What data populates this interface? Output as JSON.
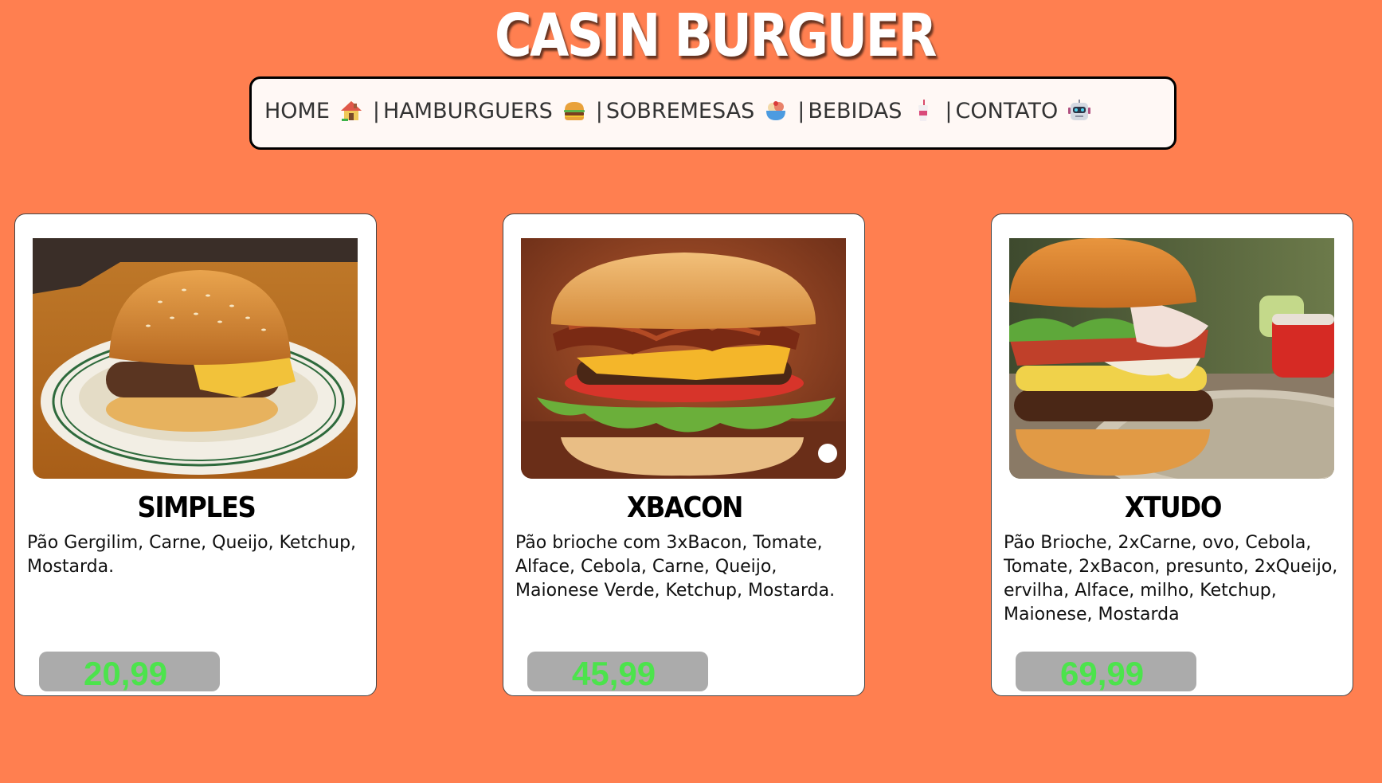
{
  "site": {
    "title": "CASIN BURGUER",
    "background_color": "#FF7F50"
  },
  "nav": {
    "items": [
      {
        "label": "HOME",
        "icon": "house-icon",
        "separator": ""
      },
      {
        "label": "HAMBURGUERS",
        "icon": "burger-icon",
        "separator": "|"
      },
      {
        "label": "SOBREMESAS",
        "icon": "dessert-bowl-icon",
        "separator": "|"
      },
      {
        "label": "BEBIDAS",
        "icon": "drink-cup-icon",
        "separator": "|"
      },
      {
        "label": "CONTATO",
        "icon": "robot-icon",
        "separator": "|"
      }
    ]
  },
  "products": [
    {
      "name": "SIMPLES",
      "description": "Pão Gergilim, Carne, Queijo, Ketchup, Mostarda.",
      "price": "20,99",
      "image": "simple-cheeseburger-on-plate"
    },
    {
      "name": "XBACON",
      "description": "Pão brioche com 3xBacon, Tomate, Alface, Cebola, Carne, Queijo, Maionese Verde, Ketchup, Mostarda.",
      "price": "45,99",
      "image": "bacon-cheeseburger"
    },
    {
      "name": "XTUDO",
      "description": "Pão Brioche, 2xCarne, ovo, Cebola, Tomate, 2xBacon, presunto, 2xQueijo, ervilha, Alface, milho, Ketchup, Maionese, Mostarda",
      "price": "69,99",
      "image": "loaded-burger-with-egg"
    }
  ],
  "colors": {
    "price_text": "#4CE34C",
    "price_bg": "#ABABAB",
    "card_bg": "#FFFFFF",
    "nav_bg": "#FFF8F5"
  }
}
